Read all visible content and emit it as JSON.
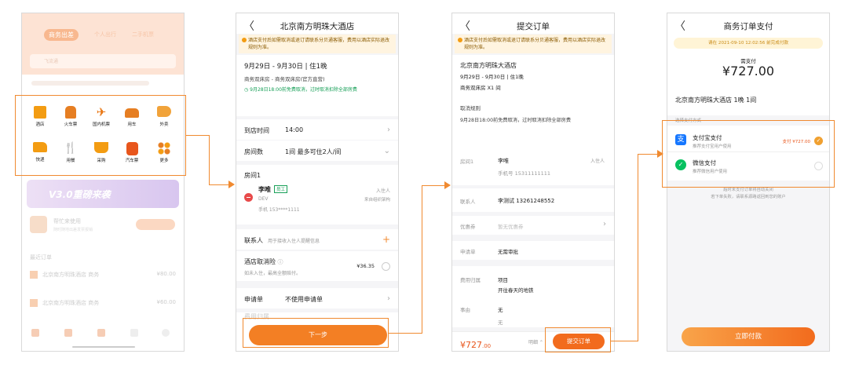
{
  "home": {
    "tabs": [
      "商务出差",
      "个人出行",
      "二手机票"
    ],
    "header_label": "飞流通",
    "grid_row1": [
      "酒店",
      "火车票",
      "国内机票",
      "用车",
      "外卖"
    ],
    "grid_row2": [
      "快递",
      "用餐",
      "采购",
      "汽车票",
      "更多"
    ],
    "banner": "V3.0重磅来袭",
    "card_title": "帮忙来使用",
    "card_sub": "随时随地出差发票报销",
    "recent_title": "最近订单",
    "recent_items": [
      {
        "name": "北京南方明珠酒店 商务",
        "price": "¥80.00"
      },
      {
        "name": "北京南方明珠酒店 商务",
        "price": "¥60.00"
      }
    ]
  },
  "hotel": {
    "title": "北京南方明珠大酒店",
    "notice": "酒店支付后如需取消或退订请联系分贝通客服，费用以酒店实际退改规则为准。",
    "dates": "9月29日 - 9月30日 | 住1晚",
    "room_type": "商务双床房 - 商务双床房(官方直营)",
    "free_cancel": "9月28日18:00前免费取消，过时取消扣除全部房费",
    "arrive_label": "到店时间",
    "arrive_value": "14:00",
    "rooms_label": "房间数",
    "rooms_value": "1间  最多可住2人/间",
    "room1_label": "房间1",
    "guest_name": "李唯",
    "guest_tag": "员工",
    "guest_dept": "DEV",
    "guest_phone": "手机 153****1111",
    "guest_right1": "入住人",
    "guest_right2": "来自组织架构",
    "contact_label": "联系人",
    "contact_hint": "用于接收入住人提醒信息",
    "insurance_label": "酒店取消险",
    "insurance_sub": "如未入住，最高全额赔付。",
    "insurance_price": "¥36.35",
    "apply_label": "申请单",
    "apply_value": "不使用申请单",
    "more_label": "费用归属",
    "next_button": "下一步"
  },
  "submit": {
    "title": "提交订单",
    "notice": "酒店支付后如需取消或退订请联系分贝通客服，费用以酒店实际退改规则为准。",
    "hotel_name": "北京南方明珠大酒店",
    "dates": "9月29日 - 9月30日 | 住1晚",
    "room": "商务双床房 X1 间",
    "cancel_rule_label": "取消规则",
    "cancel_rule": "9月28日18:00前免费取消，过时取消扣除全部房费",
    "room1_label": "房间1",
    "guest_name": "李唯",
    "guest_tag": "入住人",
    "guest_phone": "手机号 15311111111",
    "contact_label": "联系人",
    "contact_value": "李测试 13261248552",
    "coupon_label": "优惠券",
    "coupon_value": "暂无优惠券",
    "apply_label": "申请单",
    "apply_value": "无需审批",
    "cost_label": "费用归属",
    "cost_value1": "项目",
    "cost_value2": "开往春天的地铁",
    "reason_label": "事由",
    "reason_value": "无",
    "reason_value2": "无",
    "total": "¥727",
    "total_dec": ".00",
    "detail": "明细",
    "submit_button": "提交订单"
  },
  "pay": {
    "title": "商务订单支付",
    "deadline": "请在 2021-09-10 12:02:56 前完成付款",
    "amount_label": "需支付",
    "amount": "¥727.00",
    "order_desc": "北京南方明珠大酒店 1晚 1间",
    "method_title": "选择支付方式",
    "alipay_name": "支付宝支付",
    "alipay_sub": "推荐支付宝用户使用",
    "alipay_amount": "支付 ¥727.00",
    "wechat_name": "微信支付",
    "wechat_sub": "推荐微信用户使用",
    "note1": "超时未支付订单将自动关闭",
    "note2": "若下单失败，请联系源路返回到您的账户",
    "pay_button": "立即付款"
  },
  "colors": {
    "accent": "#f08a30",
    "button": "#f26b1d",
    "alipay": "#1677ff",
    "wechat": "#07c160"
  }
}
